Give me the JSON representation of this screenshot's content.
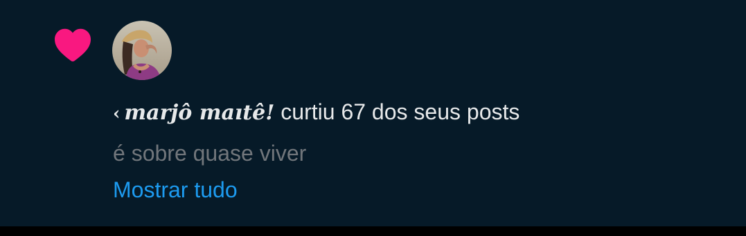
{
  "notification": {
    "user_prefix": "‹",
    "user_name": "𝒎𝒂𝒓𝒋ô 𝒎𝒂ıtê!",
    "action_text": " curtiu 67 dos seus posts",
    "post_preview": "é sobre quase viver",
    "show_all_label": "Mostrar tudo"
  },
  "icons": {
    "like": "heart-icon",
    "like_color": "#f91880"
  },
  "colors": {
    "background": "#061a28",
    "text_primary": "#e7e9ea",
    "text_secondary": "#71767b",
    "link": "#1d9bf0"
  }
}
